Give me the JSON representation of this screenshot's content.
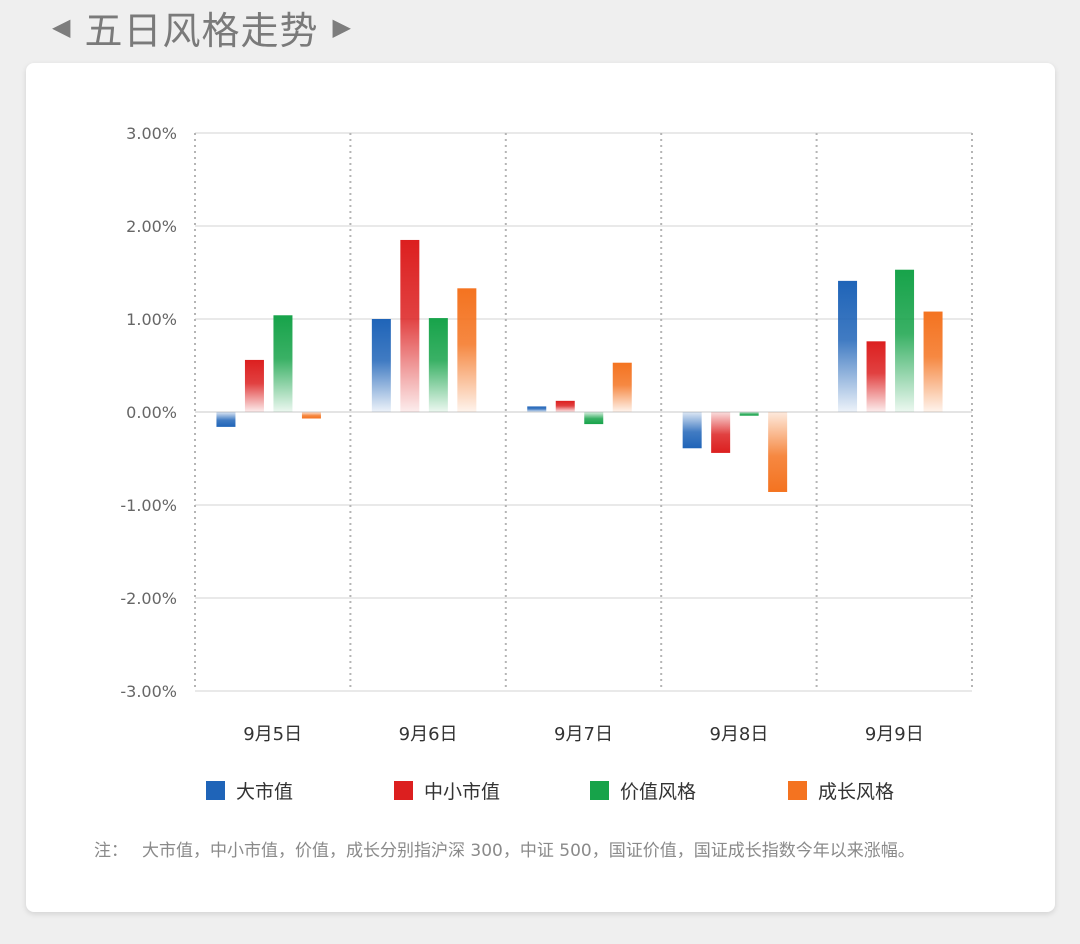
{
  "header": {
    "title": "五日风格走势",
    "left_arrow_icon": "triangle-left-icon",
    "right_arrow_icon": "triangle-right-icon"
  },
  "chart_data": {
    "type": "bar",
    "categories": [
      "9月5日",
      "9月6日",
      "9月7日",
      "9月8日",
      "9月9日"
    ],
    "series": [
      {
        "name": "大市值",
        "color": "#1f64b8",
        "values": [
          -0.16,
          1.0,
          0.06,
          -0.39,
          1.41
        ]
      },
      {
        "name": "中小市值",
        "color": "#dc1f1f",
        "values": [
          0.56,
          1.85,
          0.12,
          -0.44,
          0.76
        ]
      },
      {
        "name": "价值风格",
        "color": "#17a34a",
        "values": [
          1.04,
          1.01,
          -0.13,
          -0.04,
          1.53
        ]
      },
      {
        "name": "成长风格",
        "color": "#f47320",
        "values": [
          -0.07,
          1.33,
          0.53,
          -0.86,
          1.08
        ]
      }
    ],
    "ylim": [
      -3,
      3
    ],
    "yticks": [
      3,
      2,
      1,
      0,
      -1,
      -2,
      -3
    ],
    "ytick_labels": [
      "3.00%",
      "2.00%",
      "1.00%",
      "0.00%",
      "-1.00%",
      "-2.00%",
      "-3.00%"
    ],
    "grid": true,
    "legend_position": "bottom",
    "xlabel": "",
    "ylabel": ""
  },
  "note": {
    "label": "注：",
    "text": "大市值，中小市值，价值，成长分别指沪深 300，中证 500，国证价值，国证成长指数今年以来涨幅。"
  }
}
